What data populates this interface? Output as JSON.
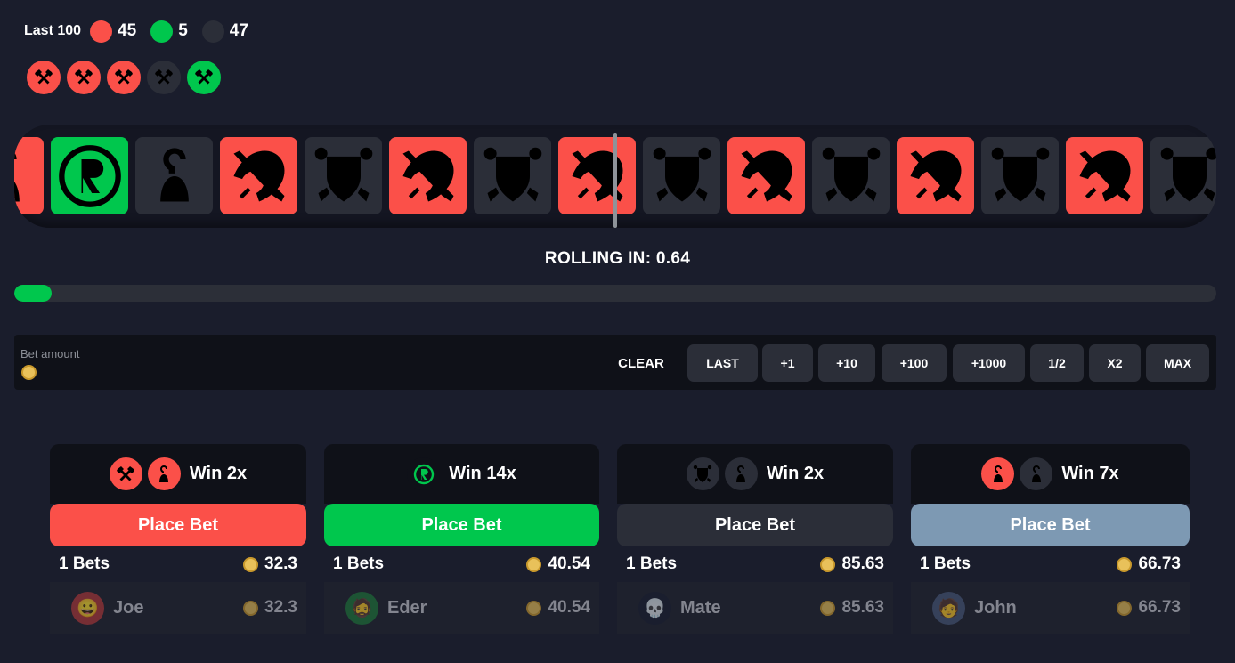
{
  "header": {
    "label": "Last 100",
    "counts": [
      {
        "color": "#fb5049",
        "value": "45"
      },
      {
        "color": "#00c74d",
        "value": "5"
      },
      {
        "color": "#2b2e38",
        "value": "47"
      }
    ],
    "recent_icons": [
      {
        "icon": "crossed-hammers-icon",
        "color": "#fb5049"
      },
      {
        "icon": "crossed-hammers-icon",
        "color": "#fb5049"
      },
      {
        "icon": "crossed-hammers-icon",
        "color": "#fb5049"
      },
      {
        "icon": "crossed-hammers-icon",
        "color": "#2b2e38"
      },
      {
        "icon": "crossed-hammers-icon",
        "color": "#00c74d"
      }
    ]
  },
  "roller": {
    "tiles": [
      {
        "icon": "hook-icon",
        "color": "#fb5049"
      },
      {
        "icon": "r-logo-icon",
        "color": "#00c74d"
      },
      {
        "icon": "hook-icon",
        "color": "#2b2e38"
      },
      {
        "icon": "sword-axe-icon",
        "color": "#fb5049"
      },
      {
        "icon": "shield-crest-icon",
        "color": "#2b2e38"
      },
      {
        "icon": "sword-axe-icon",
        "color": "#fb5049"
      },
      {
        "icon": "shield-crest-icon",
        "color": "#2b2e38"
      },
      {
        "icon": "sword-axe-icon",
        "color": "#fb5049"
      },
      {
        "icon": "shield-crest-icon",
        "color": "#2b2e38"
      },
      {
        "icon": "sword-axe-icon",
        "color": "#fb5049"
      },
      {
        "icon": "shield-crest-icon",
        "color": "#2b2e38"
      },
      {
        "icon": "sword-axe-icon",
        "color": "#fb5049"
      },
      {
        "icon": "shield-crest-icon",
        "color": "#2b2e38"
      },
      {
        "icon": "sword-axe-icon",
        "color": "#fb5049"
      },
      {
        "icon": "shield-crest-icon",
        "color": "#2b2e38"
      }
    ]
  },
  "rolling_text": "ROLLING IN: 0.64",
  "progress": {
    "fraction": 0.031
  },
  "bet_bar": {
    "label": "Bet amount",
    "clear": "CLEAR",
    "buttons": [
      "LAST",
      "+1",
      "+10",
      "+100",
      "+1000",
      "1/2",
      "X2",
      "MAX"
    ]
  },
  "columns": [
    {
      "icons": [
        {
          "icon": "crossed-hammers-icon",
          "color": "#fb5049"
        },
        {
          "icon": "hook-icon",
          "color": "#fb5049"
        }
      ],
      "win": "Win 2x",
      "place_label": "Place Bet",
      "button_color": "#fb5049",
      "bets": "1 Bets",
      "total": "32.3",
      "players": [
        {
          "name": "Joe",
          "amount": "32.3",
          "avatar": "😀"
        }
      ]
    },
    {
      "icons": [
        {
          "icon": "r-logo-icon",
          "color": "#00c74d"
        }
      ],
      "win": "Win 14x",
      "place_label": "Place Bet",
      "button_color": "#00c74d",
      "bets": "1 Bets",
      "total": "40.54",
      "players": [
        {
          "name": "Eder",
          "amount": "40.54",
          "avatar": "🧔"
        }
      ]
    },
    {
      "icons": [
        {
          "icon": "shield-crest-icon",
          "color": "#2b2e38"
        },
        {
          "icon": "hook-icon",
          "color": "#2b2e38"
        }
      ],
      "win": "Win 2x",
      "place_label": "Place Bet",
      "button_color": "#2b2e38",
      "bets": "1 Bets",
      "total": "85.63",
      "players": [
        {
          "name": "Mate",
          "amount": "85.63",
          "avatar": "💀"
        }
      ]
    },
    {
      "icons": [
        {
          "icon": "hook-icon",
          "color": "#fb5049"
        },
        {
          "icon": "hook-icon",
          "color": "#2b2e38"
        }
      ],
      "win": "Win 7x",
      "place_label": "Place Bet",
      "button_color": "#7d99b3",
      "bets": "1 Bets",
      "total": "66.73",
      "players": [
        {
          "name": "John",
          "amount": "66.73",
          "avatar": "🧑"
        }
      ]
    }
  ]
}
